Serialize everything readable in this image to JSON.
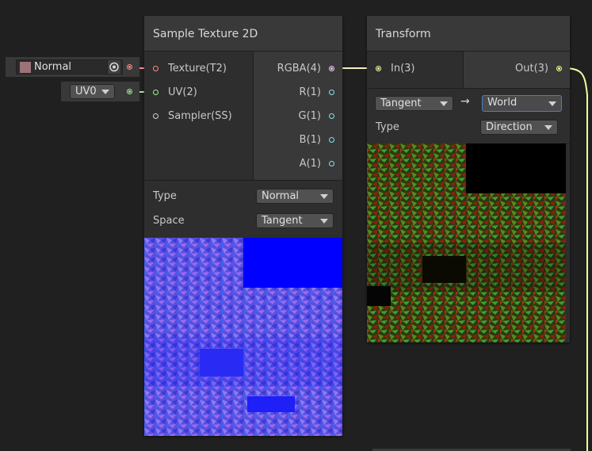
{
  "colors": {
    "texture": "#ff8b8b",
    "uv": "#9aef92",
    "sampler": "#d0d0d0",
    "rgba": "#fbcbf4",
    "vector1": "#84e4e7",
    "vector3": "#f6ff9a",
    "normal_swatch": "#9c7377"
  },
  "inline_inputs": {
    "texture": {
      "label": "Normal",
      "icon": "object-picker-icon"
    },
    "uv": {
      "value": "UV0"
    }
  },
  "sample_node": {
    "title": "Sample Texture 2D",
    "inputs": [
      {
        "label": "Texture(T2)"
      },
      {
        "label": "UV(2)"
      },
      {
        "label": "Sampler(SS)"
      }
    ],
    "outputs": [
      {
        "label": "RGBA(4)"
      },
      {
        "label": "R(1)"
      },
      {
        "label": "G(1)"
      },
      {
        "label": "B(1)"
      },
      {
        "label": "A(1)"
      }
    ],
    "type_label": "Type",
    "type_value": "Normal",
    "space_label": "Space",
    "space_value": "Tangent"
  },
  "transform_node": {
    "title": "Transform",
    "input": {
      "label": "In(3)"
    },
    "output": {
      "label": "Out(3)"
    },
    "from_value": "Tangent",
    "arrow": "→",
    "to_value": "World",
    "type_label": "Type",
    "type_value": "Direction"
  }
}
